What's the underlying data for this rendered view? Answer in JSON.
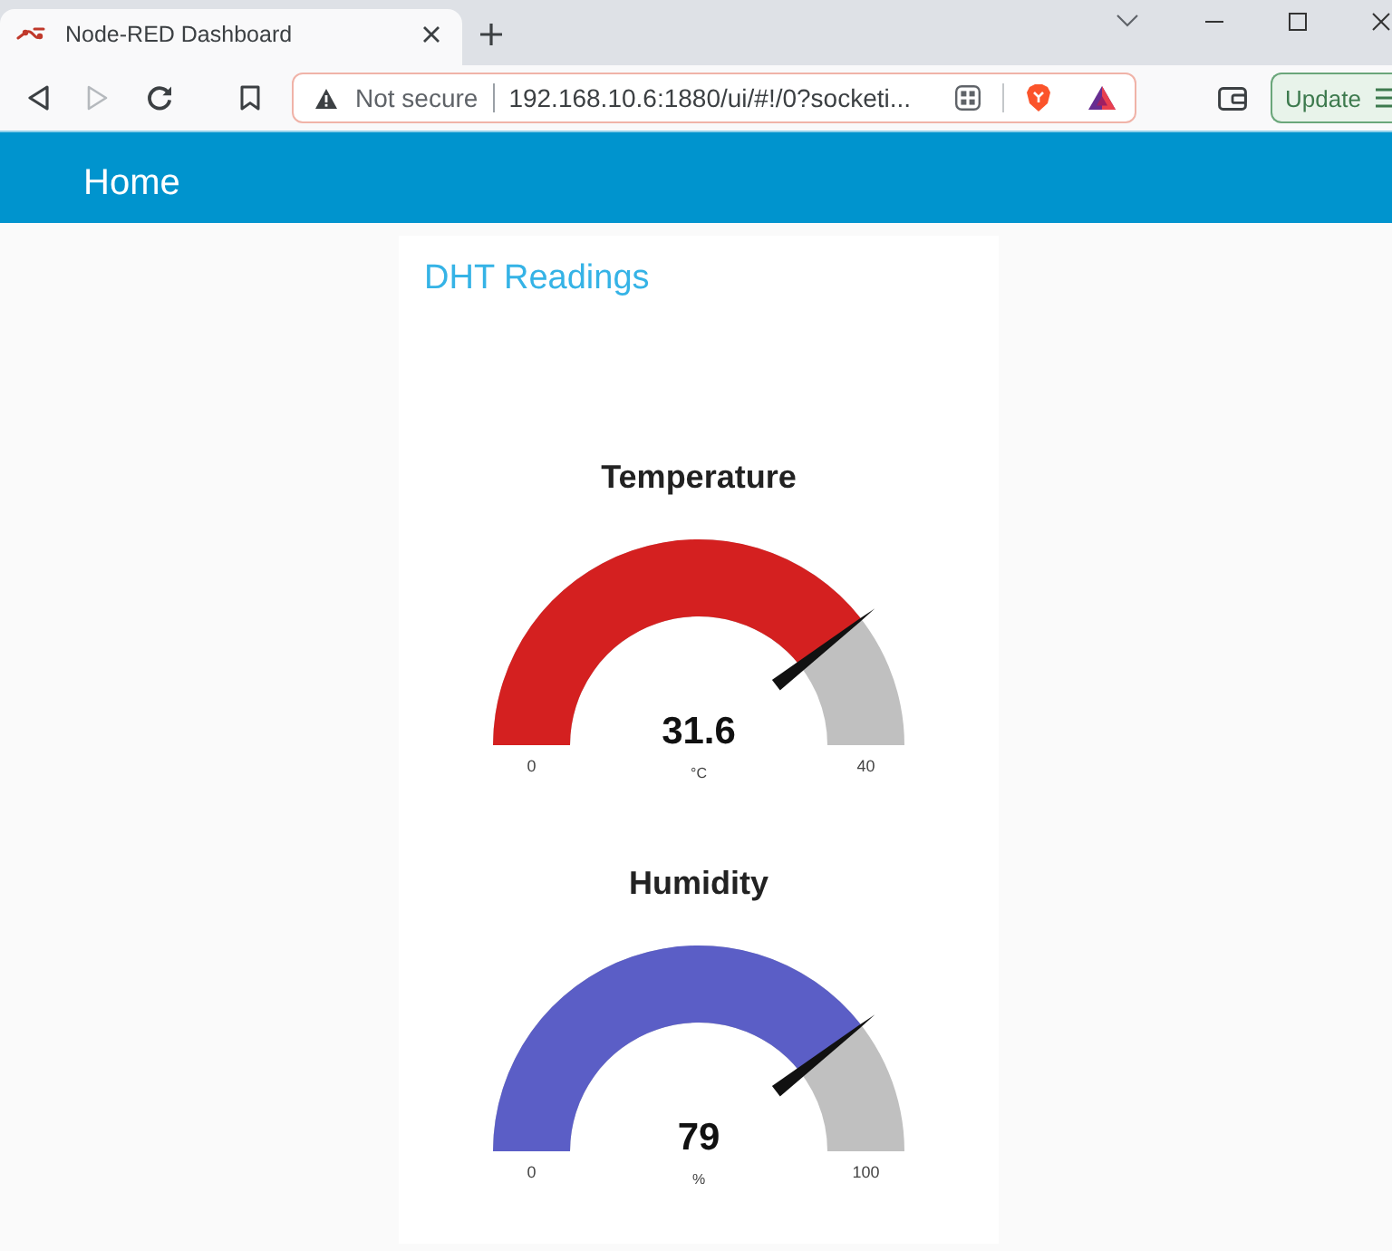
{
  "browser": {
    "tabs": [
      {
        "title": "Node-RED Dashboard",
        "selected": true
      }
    ],
    "nav_buttons": [
      {
        "kind": "back",
        "disabled": false
      },
      {
        "kind": "forward",
        "disabled": true
      },
      {
        "kind": "reload",
        "disabled": false
      }
    ],
    "address_bar": {
      "security": "Not secure",
      "url": "192.168.10.6:1880/ui/#!/0?socketi..."
    },
    "update_button": {
      "label": "Update"
    }
  },
  "header": {
    "title": "Home"
  },
  "group": {
    "title": "DHT Readings",
    "gauges": [
      {
        "title": "Temperature",
        "value": "31.6",
        "unit": "°C",
        "min": "0",
        "max": "40",
        "level": 0.79,
        "color": "#d42020"
      },
      {
        "title": "Humidity",
        "value": "79",
        "unit": "%",
        "min": "0",
        "max": "100",
        "level": 0.79,
        "color": "#5b5ec6"
      }
    ]
  }
}
